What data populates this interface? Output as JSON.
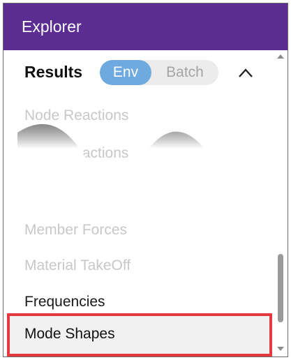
{
  "panel": {
    "title": "Explorer"
  },
  "results": {
    "label": "Results",
    "toggle": {
      "env_label": "Env",
      "batch_label": "Batch",
      "selected": "Env"
    }
  },
  "items": [
    {
      "label": "Node Reactions"
    },
    {
      "label": "Node Reactions"
    },
    {
      "label": "Member Forces"
    },
    {
      "label": "Material TakeOff"
    },
    {
      "label": "Frequencies"
    },
    {
      "label": "Mode Shapes"
    }
  ],
  "icons": {
    "collapse": "chevron-up-icon",
    "scroll_up": "triangle-up-icon",
    "scroll_down": "triangle-down-icon"
  },
  "colors": {
    "titlebar": "#5b2d92",
    "toggle_active": "#6ea9e0",
    "selection_border": "#e23a3e"
  }
}
